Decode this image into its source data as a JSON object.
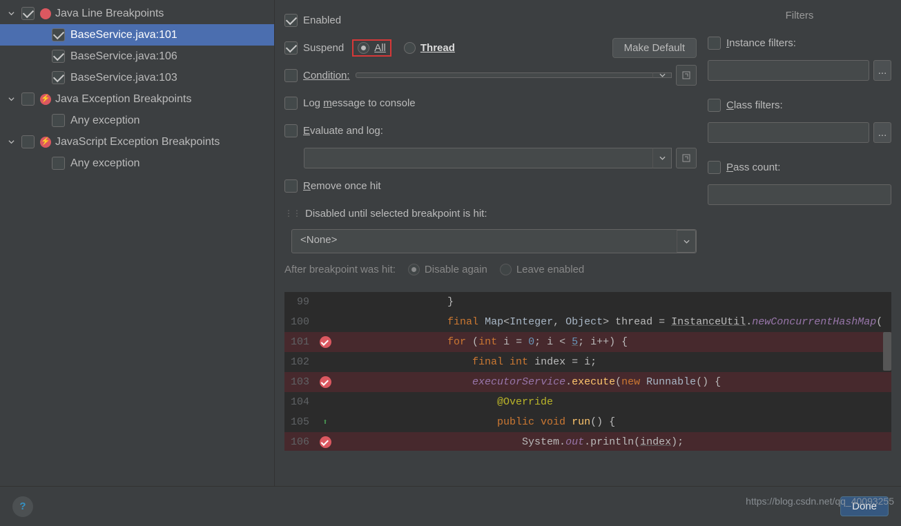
{
  "tree": {
    "group0": {
      "label": "Java Line Breakpoints",
      "checked": true
    },
    "bp0": {
      "label": "BaseService.java:101",
      "checked": true,
      "selected": true
    },
    "bp1": {
      "label": "BaseService.java:106",
      "checked": true
    },
    "bp2": {
      "label": "BaseService.java:103",
      "checked": true
    },
    "group1": {
      "label": "Java Exception Breakpoints",
      "checked": false
    },
    "g1i0": {
      "label": "Any exception",
      "checked": false
    },
    "group2": {
      "label": "JavaScript Exception Breakpoints",
      "checked": false
    },
    "g2i0": {
      "label": "Any exception",
      "checked": false
    }
  },
  "opts": {
    "enabled": "Enabled",
    "suspend": "Suspend",
    "all": "All",
    "thread": "Thread",
    "make_default": "Make Default",
    "condition": "Condition:",
    "log_console": "Log message to console",
    "evaluate_log": "Evaluate and log:",
    "remove_once": "Remove once hit",
    "disabled_until": "Disabled until selected breakpoint is hit:",
    "none": "<None>",
    "after_hit": "After breakpoint was hit:",
    "disable_again": "Disable again",
    "leave_enabled": "Leave enabled"
  },
  "filters": {
    "title": "Filters",
    "instance": "Instance filters:",
    "class": "Class filters:",
    "pass": "Pass count:",
    "dots": "..."
  },
  "code": {
    "l99": {
      "n": "99",
      "txt": "                    }"
    },
    "l100": {
      "n": "100"
    },
    "l101": {
      "n": "101"
    },
    "l102": {
      "n": "102"
    },
    "l103": {
      "n": "103"
    },
    "l104": {
      "n": "104"
    },
    "l105": {
      "n": "105"
    },
    "l106": {
      "n": "106"
    }
  },
  "footer": {
    "done": "Done",
    "help": "?"
  },
  "watermark": "https://blog.csdn.net/qq_40093255"
}
